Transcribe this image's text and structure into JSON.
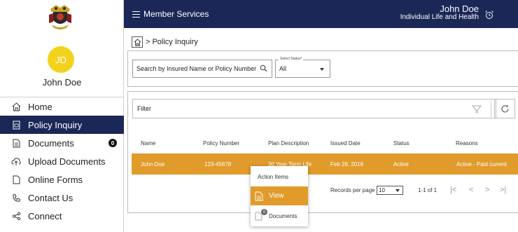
{
  "user": {
    "initials": "JD",
    "name": "John Doe"
  },
  "sidebar": {
    "items": [
      {
        "label": "Home",
        "icon": "home-icon"
      },
      {
        "label": "Policy Inquiry",
        "icon": "policy-doc-icon"
      },
      {
        "label": "Documents",
        "icon": "document-icon",
        "badge": "0"
      },
      {
        "label": "Upload Documents",
        "icon": "upload-cloud-icon"
      },
      {
        "label": "Online Forms",
        "icon": "form-icon"
      },
      {
        "label": "Contact Us",
        "icon": "phone-icon"
      },
      {
        "label": "Connect",
        "icon": "share-icon"
      }
    ]
  },
  "header": {
    "menu_label": "Member Services",
    "user_name": "John Doe",
    "user_sub": "Individual Life and Health"
  },
  "breadcrumb": {
    "separator": ">",
    "current": "Policy Inquiry"
  },
  "search": {
    "placeholder": "Search by Insured Name or Policy Number",
    "status_label": "Select Status*",
    "status_value": "All"
  },
  "filter": {
    "label": "Filter"
  },
  "table": {
    "columns": [
      "Name",
      "Policy Number",
      "Plan Description",
      "Issued Date",
      "Status",
      "Reasons"
    ],
    "rows": [
      [
        "John Doe",
        "123-45678",
        "30 Year Term Life",
        "Feb 26, 2016",
        "Active",
        "Active - Paid current"
      ]
    ]
  },
  "pagination": {
    "records_label": "Records per page",
    "per_page": "10",
    "range": "1-1 of 1",
    "first": "|<",
    "prev": "<",
    "next": ">",
    "last": ">|"
  },
  "context_menu": {
    "title": "Action Items",
    "view_label": "View",
    "documents_label": "Documents",
    "documents_badge": "0"
  },
  "colors": {
    "navy": "#1b2757",
    "accent": "#e19b2b",
    "avatar": "#f3d21c"
  }
}
